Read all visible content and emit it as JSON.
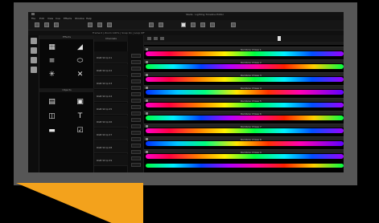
{
  "window": {
    "title": "Stella · Lighting Timeline Editor"
  },
  "menu": [
    "File",
    "Edit",
    "View",
    "Cue",
    "Effects",
    "Window",
    "Help"
  ],
  "subbar": {
    "text": "Frame 0  |  Zoom 100%  |  Snap On  |  Loop Off"
  },
  "library": {
    "panel1_title": "Effects",
    "panel2_title": "Objects",
    "effects_icons": [
      "grid-icon",
      "ramp-icon",
      "bars-icon",
      "oval-icon",
      "sparkle-icon",
      "cross-icon"
    ],
    "object_icons": [
      "table-icon",
      "image-icon",
      "frame-icon",
      "text-icon",
      "film-icon",
      "checkbox-icon"
    ]
  },
  "namecol": {
    "header": "Channels"
  },
  "rows": [
    {
      "name": "RGB Strip 01",
      "cue": "Rainbow Chase 1"
    },
    {
      "name": "RGB Strip 02",
      "cue": "Rainbow Chase 2"
    },
    {
      "name": "RGB Strip 03",
      "cue": "Rainbow Chase 3"
    },
    {
      "name": "RGB Strip 04",
      "cue": "Rainbow Chase 4"
    },
    {
      "name": "RGB Strip 05",
      "cue": "Rainbow Chase 5"
    },
    {
      "name": "RGB Strip 06",
      "cue": "Rainbow Chase 6"
    },
    {
      "name": "RGB Strip 07",
      "cue": "Rainbow Chase 7"
    },
    {
      "name": "RGB Strip 08",
      "cue": "Rainbow Chase 8"
    },
    {
      "name": "RGB Strip 09",
      "cue": "Rainbow Chase 9"
    }
  ],
  "colors": {
    "accent": "#f3a21c",
    "frame": "#565656"
  }
}
